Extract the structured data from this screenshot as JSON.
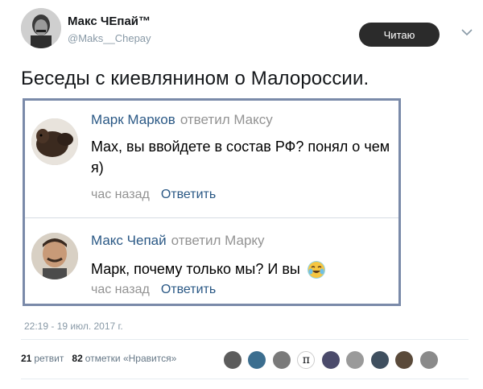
{
  "tweet": {
    "author_name": "Макс ЧЕпай™",
    "author_handle": "@Maks__Chepay",
    "follow_label": "Читаю",
    "text": "Беседы с киевлянином о Малороссии.",
    "timestamp": "22:19 - 19 июл. 2017 г."
  },
  "comments": [
    {
      "author": "Марк Марков",
      "action": "ответил Максу",
      "text": "Max, вы ввойдете в состав РФ? понял о чем я)",
      "time": "час назад",
      "reply": "Ответить"
    },
    {
      "author": "Макс Чепай",
      "action": "ответил Марку",
      "text": "Марк, почему только мы? И вы",
      "time": "час назад",
      "reply": "Ответить"
    }
  ],
  "stats": {
    "retweets": "21",
    "retweets_label": "ретвит",
    "likes": "82",
    "likes_label": "отметки «Нравится»"
  },
  "likers_count": 9,
  "icons": {
    "chevron": "chevron-down-icon",
    "emoji": "tears-of-joy-emoji-icon"
  },
  "colors": {
    "link": "#2a5885",
    "muted": "#939393",
    "border": "#7a8aa9",
    "button": "#2b2b2b"
  }
}
